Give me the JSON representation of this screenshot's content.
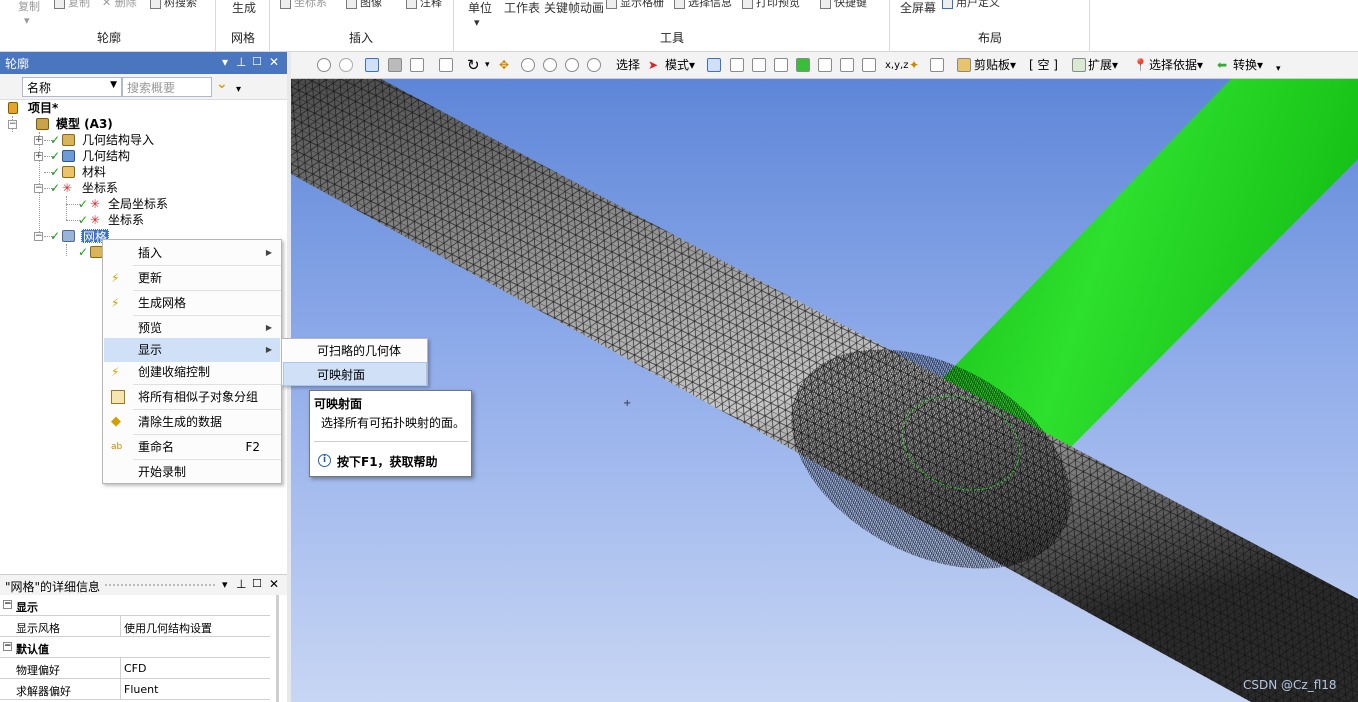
{
  "ribbon": {
    "sections": [
      {
        "label": "轮廓",
        "items": [
          "复制",
          "复制",
          "删除",
          "树搜索"
        ]
      },
      {
        "label": "网格",
        "items": [
          "生成"
        ]
      },
      {
        "label": "插入",
        "items": [
          "坐标系",
          "注释",
          "图像",
          "注释"
        ]
      },
      {
        "label": "工具",
        "items": [
          "单位",
          "工作表",
          "关键帧动画",
          "显示格栅",
          "选择信息",
          "打印预览",
          "快捷键"
        ]
      },
      {
        "label": "布局",
        "items": [
          "全屏幕",
          "用户定义"
        ]
      }
    ]
  },
  "outline": {
    "title": "轮廓",
    "filter_select": "名称",
    "search_placeholder": "搜索概要",
    "tree": {
      "project": "项目*",
      "model": "模型 (A3)",
      "geometry_import": "几何结构导入",
      "geometry": "几何结构",
      "materials": "材料",
      "coord_systems": "坐标系",
      "global_cs": "全局坐标系",
      "cs": "坐标系",
      "mesh": "网格"
    }
  },
  "details": {
    "title": "\"网格\"的详细信息",
    "sections": [
      {
        "header": "显示",
        "rows": [
          {
            "key": "显示风格",
            "value": "使用几何结构设置"
          }
        ]
      },
      {
        "header": "默认值",
        "rows": [
          {
            "key": "物理偏好",
            "value": "CFD"
          },
          {
            "key": "求解器偏好",
            "value": "Fluent"
          }
        ]
      }
    ]
  },
  "toolbar": {
    "select": "选择",
    "mode": "模式",
    "clipboard": "剪贴板",
    "empty": "[ 空 ]",
    "extend": "扩展",
    "select_by": "选择依据",
    "convert": "转换"
  },
  "context_menu": {
    "items": [
      {
        "label": "插入",
        "submenu": true
      },
      {
        "label": "更新"
      },
      {
        "label": "生成网格"
      },
      {
        "label": "预览",
        "submenu": true
      },
      {
        "label": "显示",
        "submenu": true
      },
      {
        "label": "创建收缩控制"
      },
      {
        "label": "将所有相似子对象分组"
      },
      {
        "label": "清除生成的数据"
      },
      {
        "label": "重命名",
        "shortcut": "F2"
      },
      {
        "label": "开始录制"
      }
    ]
  },
  "submenu": {
    "items": [
      "可扫略的几何体",
      "可映射面"
    ]
  },
  "tooltip": {
    "title": "可映射面",
    "body": "选择所有可拓扑映射的面。",
    "help": "按下F1，获取帮助"
  },
  "watermark": "CSDN @Cz_fl18",
  "colors": {
    "accent_bar": "#4a76c0",
    "highlight": "#cfe0f7",
    "pipe_green": "#1fd31f",
    "bg_top": "#5e86d8",
    "bg_bottom": "#c8d6f4"
  }
}
